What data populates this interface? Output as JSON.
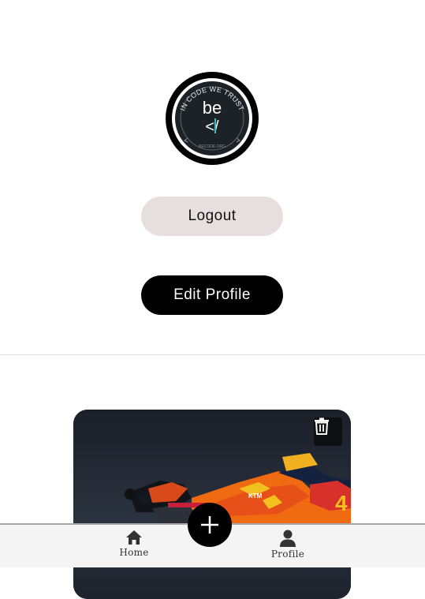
{
  "profile": {
    "avatar_icon": "in-code-we-trust-logo"
  },
  "actions": {
    "logout_label": "Logout",
    "edit_profile_label": "Edit Profile"
  },
  "post": {
    "image_icon": "motorcycle-photo",
    "delete_icon": "trash-icon"
  },
  "nav": {
    "home_label": "Home",
    "home_icon": "home-icon",
    "profile_label": "Profile",
    "profile_icon": "user-icon",
    "add_icon": "plus-icon"
  },
  "colors": {
    "logout_bg": "#e7dfdf",
    "edit_bg": "#000000",
    "nav_bg": "#f4f4f4",
    "accent_teal": "#3fb8c9"
  }
}
